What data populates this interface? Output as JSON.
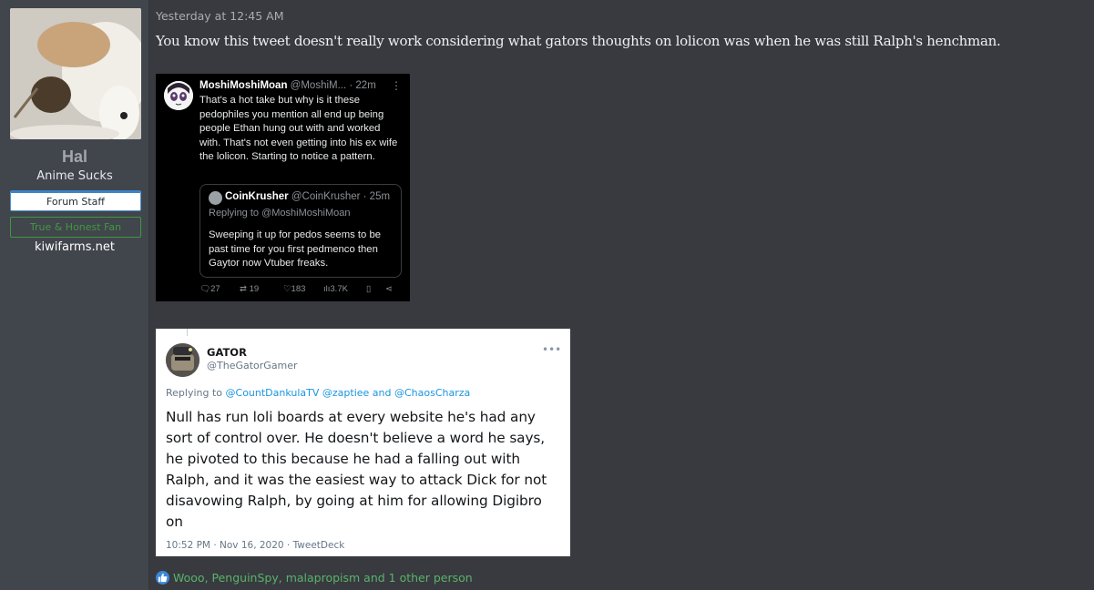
{
  "user": {
    "name": "Hal",
    "title": "Anime Sucks",
    "banners": [
      "Forum Staff",
      "True & Honest Fan"
    ],
    "site": "kiwifarms.net"
  },
  "post": {
    "timestamp": "Yesterday at 12:45 AM",
    "text": "You know this tweet doesn't really work considering what gators thoughts on lolicon was when he was still Ralph's henchman."
  },
  "tweet1": {
    "name": "MoshiMoshiMoan",
    "handle": "@MoshiM...",
    "time": "· 22m",
    "body": "That's a hot take but why is it these pedophiles you mention all end up being people Ethan hung out with and worked with.  That's not even getting into his ex wife the lolicon.  Starting to notice a pattern.",
    "quote": {
      "name": "CoinKrusher",
      "handle": "@CoinKrusher · 25m",
      "replying": "Replying to @MoshiMoshiMoan",
      "body": "Sweeping it up for pedos seems to be past time for you first pedmenco then Gaytor now Vtuber freaks."
    },
    "stats": {
      "replies": "27",
      "retweets": "19",
      "likes": "183",
      "views": "3.7K"
    }
  },
  "tweet2": {
    "name": "GATOR",
    "handle": "@TheGatorGamer",
    "replying_prefix": "Replying to ",
    "replying_mentions": "@CountDankulaTV @zaptiee and @ChaosCharza",
    "body": "Null has run loli boards at every website he's had any sort of control over. He doesn't believe a word he says, he pivoted to this because he had a falling out with Ralph, and it was the easiest way to attack Dick for not disavowing Ralph, by going at him for allowing Digibro on",
    "meta": "10:52 PM · Nov 16, 2020 · TweetDeck"
  },
  "reactions": {
    "text": "Wooo, PenguinSpy, malapropism and 1 other person",
    "icon": "like-icon",
    "color": "#59b36b"
  }
}
